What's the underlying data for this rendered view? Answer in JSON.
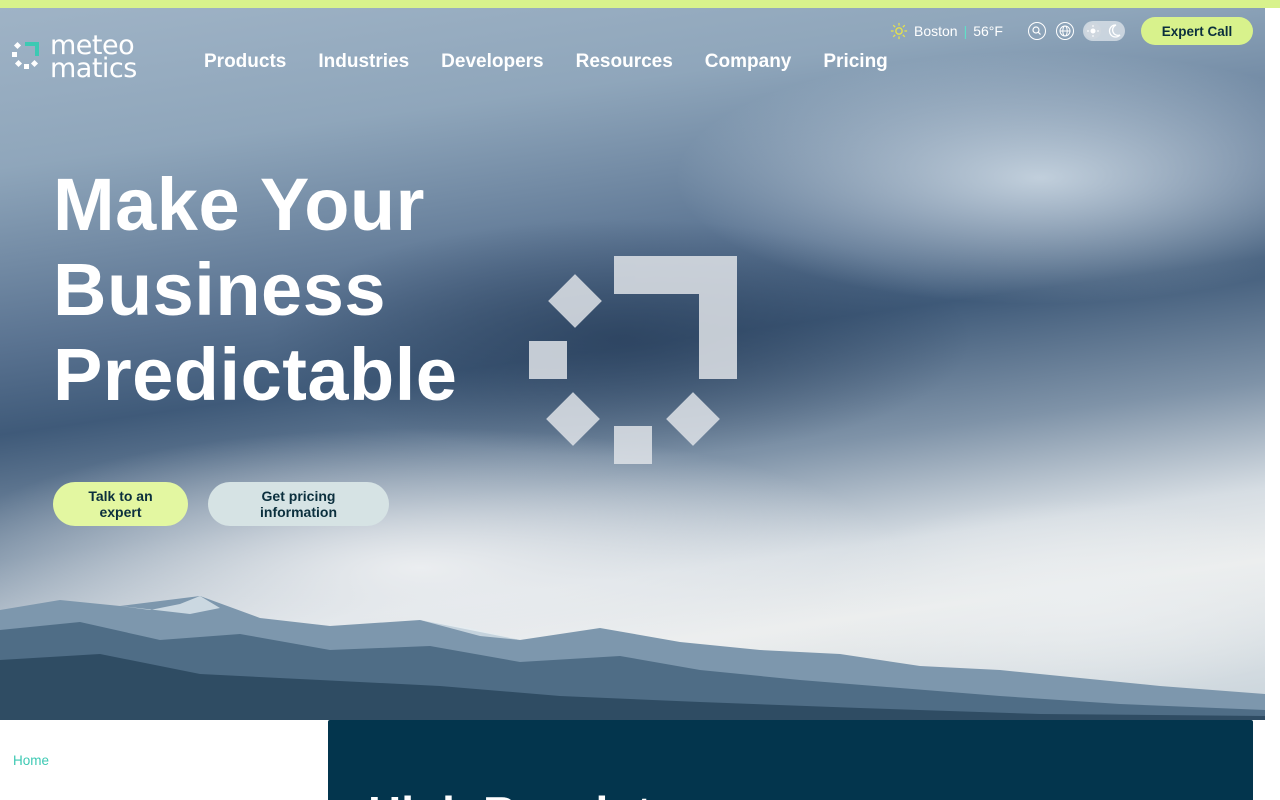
{
  "header": {
    "logo_text_line1": "meteo",
    "logo_text_line2": "matics",
    "nav": [
      "Products",
      "Industries",
      "Developers",
      "Resources",
      "Company",
      "Pricing"
    ],
    "weather": {
      "city": "Boston",
      "separator": "|",
      "temperature": "56°F",
      "icon": "sun-icon"
    },
    "icons": [
      "search-icon",
      "globe-icon",
      "sun-icon",
      "moon-icon"
    ],
    "expert_call_label": "Expert Call"
  },
  "hero": {
    "title_lines": [
      "Make Your",
      "Business",
      "Predictable"
    ],
    "primary_cta": "Talk to an expert",
    "secondary_cta": "Get pricing information"
  },
  "breadcrumb": {
    "home": "Home"
  },
  "panel": {
    "title": "High Resolut"
  },
  "colors": {
    "accent_lime": "#d8f28c",
    "accent_teal": "#3dc9b3",
    "navy": "#03354d",
    "dark_text": "#0b2f3d"
  }
}
